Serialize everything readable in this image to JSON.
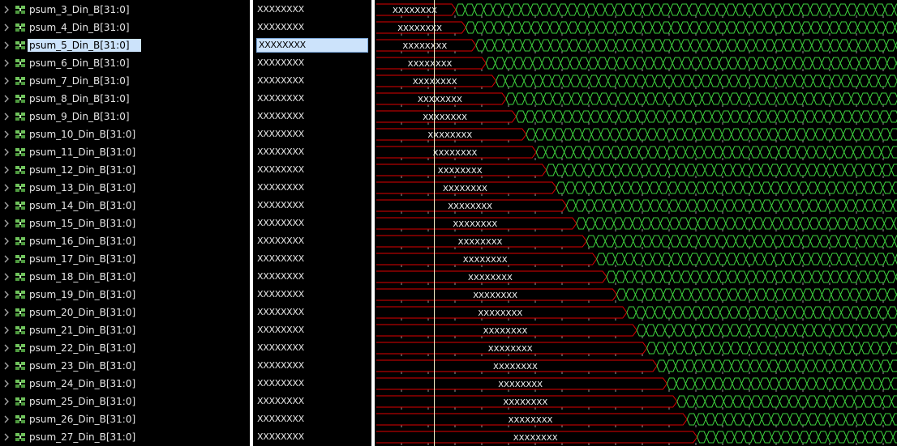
{
  "signals": [
    {
      "name": "psum_3_Din_B[31:0]",
      "value": "XXXXXXXX",
      "wave_text": "XXXXXXXX"
    },
    {
      "name": "psum_4_Din_B[31:0]",
      "value": "XXXXXXXX",
      "wave_text": "XXXXXXXX"
    },
    {
      "name": "psum_5_Din_B[31:0]",
      "value": "XXXXXXXX",
      "wave_text": "XXXXXXXX",
      "selected": true
    },
    {
      "name": "psum_6_Din_B[31:0]",
      "value": "XXXXXXXX",
      "wave_text": "XXXXXXXX"
    },
    {
      "name": "psum_7_Din_B[31:0]",
      "value": "XXXXXXXX",
      "wave_text": "XXXXXXXX"
    },
    {
      "name": "psum_8_Din_B[31:0]",
      "value": "XXXXXXXX",
      "wave_text": "XXXXXXXX"
    },
    {
      "name": "psum_9_Din_B[31:0]",
      "value": "XXXXXXXX",
      "wave_text": "XXXXXXXX"
    },
    {
      "name": "psum_10_Din_B[31:0]",
      "value": "XXXXXXXX",
      "wave_text": "XXXXXXXX"
    },
    {
      "name": "psum_11_Din_B[31:0]",
      "value": "XXXXXXXX",
      "wave_text": "XXXXXXXX"
    },
    {
      "name": "psum_12_Din_B[31:0]",
      "value": "XXXXXXXX",
      "wave_text": "XXXXXXXX"
    },
    {
      "name": "psum_13_Din_B[31:0]",
      "value": "XXXXXXXX",
      "wave_text": "XXXXXXXX"
    },
    {
      "name": "psum_14_Din_B[31:0]",
      "value": "XXXXXXXX",
      "wave_text": "XXXXXXXX"
    },
    {
      "name": "psum_15_Din_B[31:0]",
      "value": "XXXXXXXX",
      "wave_text": "XXXXXXXX"
    },
    {
      "name": "psum_16_Din_B[31:0]",
      "value": "XXXXXXXX",
      "wave_text": "XXXXXXXX"
    },
    {
      "name": "psum_17_Din_B[31:0]",
      "value": "XXXXXXXX",
      "wave_text": "XXXXXXXX"
    },
    {
      "name": "psum_18_Din_B[31:0]",
      "value": "XXXXXXXX",
      "wave_text": "XXXXXXXX"
    },
    {
      "name": "psum_19_Din_B[31:0]",
      "value": "XXXXXXXX",
      "wave_text": "XXXXXXXX"
    },
    {
      "name": "psum_20_Din_B[31:0]",
      "value": "XXXXXXXX",
      "wave_text": "XXXXXXXX"
    },
    {
      "name": "psum_21_Din_B[31:0]",
      "value": "XXXXXXXX",
      "wave_text": "XXXXXXXX"
    },
    {
      "name": "psum_22_Din_B[31:0]",
      "value": "XXXXXXXX",
      "wave_text": "XXXXXXXX"
    },
    {
      "name": "psum_23_Din_B[31:0]",
      "value": "XXXXXXXX",
      "wave_text": "XXXXXXXX"
    },
    {
      "name": "psum_24_Din_B[31:0]",
      "value": "XXXXXXXX",
      "wave_text": "XXXXXXXX"
    },
    {
      "name": "psum_25_Din_B[31:0]",
      "value": "XXXXXXXX",
      "wave_text": "XXXXXXXX"
    },
    {
      "name": "psum_26_Din_B[31:0]",
      "value": "XXXXXXXX",
      "wave_text": "XXXXXXXX"
    },
    {
      "name": "psum_27_Din_B[31:0]",
      "value": "XXXXXXXX",
      "wave_text": "XXXXXXXX"
    }
  ],
  "icons": {
    "expander": "chevron-right-icon",
    "signal": "bus-signal-icon"
  },
  "colors": {
    "undefined_bus": "#e00000",
    "toggling_bus": "#3ed23e",
    "cursor": "#f2efc8",
    "grid": "#9a9a9a",
    "selection": "#cce3fb"
  }
}
